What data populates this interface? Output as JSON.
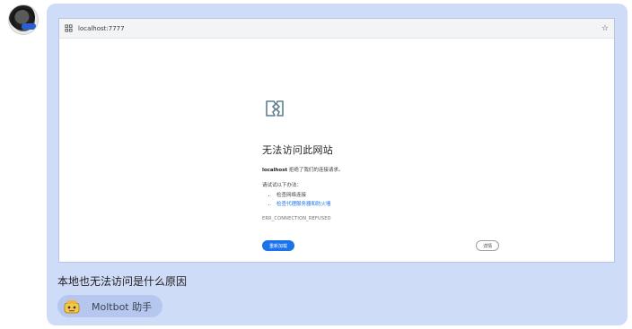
{
  "page": {
    "bubble_color": "#cfdcf8",
    "chip_color": "#b5c7ef"
  },
  "avatar": {
    "icon": "user-avatar-icon"
  },
  "screenshot": {
    "addressbar": {
      "url": "localhost:7777",
      "site_icon": "site-info-icon",
      "star_icon": "star-icon",
      "star_glyph": "☆"
    },
    "error_page": {
      "icon": "broken-document-icon",
      "title": "无法访问此网站",
      "host": "localhost",
      "message_suffix": " 拒绝了我们的连接请求。",
      "try_label": "请试试以下办法：",
      "suggestions": [
        "检查网络连接",
        "检查代理服务器和防火墙"
      ],
      "error_code": "ERR_CONNECTION_REFUSED",
      "reload_label": "重新加载",
      "details_label": "详情",
      "link_color": "#1a73e8"
    }
  },
  "message": {
    "text": "本地也无法访问是什么原因"
  },
  "chip": {
    "label": "Moltbot 助手",
    "icon": "moltbot-icon"
  }
}
